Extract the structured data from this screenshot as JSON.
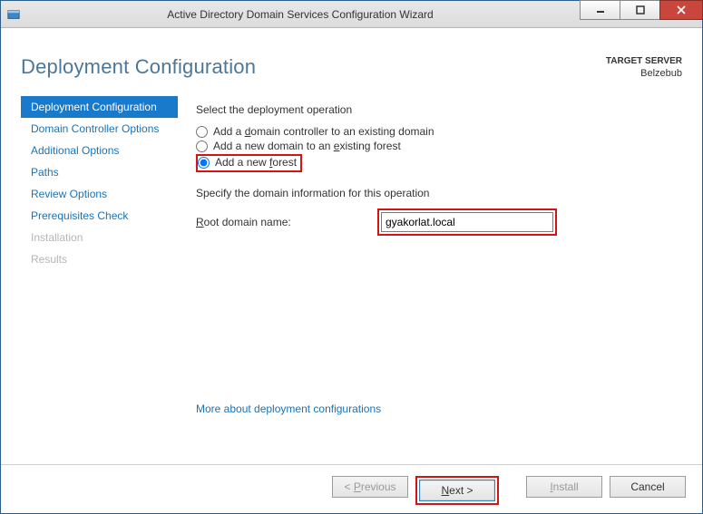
{
  "titlebar": {
    "title": "Active Directory Domain Services Configuration Wizard"
  },
  "header": {
    "heading": "Deployment Configuration",
    "target_label": "TARGET SERVER",
    "target_value": "Belzebub"
  },
  "nav": {
    "items": [
      {
        "label": "Deployment Configuration",
        "state": "selected"
      },
      {
        "label": "Domain Controller Options",
        "state": "normal"
      },
      {
        "label": "Additional Options",
        "state": "normal"
      },
      {
        "label": "Paths",
        "state": "normal"
      },
      {
        "label": "Review Options",
        "state": "normal"
      },
      {
        "label": "Prerequisites Check",
        "state": "normal"
      },
      {
        "label": "Installation",
        "state": "disabled"
      },
      {
        "label": "Results",
        "state": "disabled"
      }
    ]
  },
  "main": {
    "select_operation_label": "Select the deployment operation",
    "radios": {
      "existing_domain": "Add a domain controller to an existing domain",
      "existing_forest": "Add a new domain to an existing forest",
      "new_forest": "Add a new forest"
    },
    "selected_radio": "new_forest",
    "specify_domain_label": "Specify the domain information for this operation",
    "root_domain_label": "Root domain name:",
    "root_domain_value": "gyakorlat.local",
    "more_link": "More about deployment configurations"
  },
  "footer": {
    "previous": "< Previous",
    "next": "Next >",
    "install": "Install",
    "cancel": "Cancel"
  }
}
